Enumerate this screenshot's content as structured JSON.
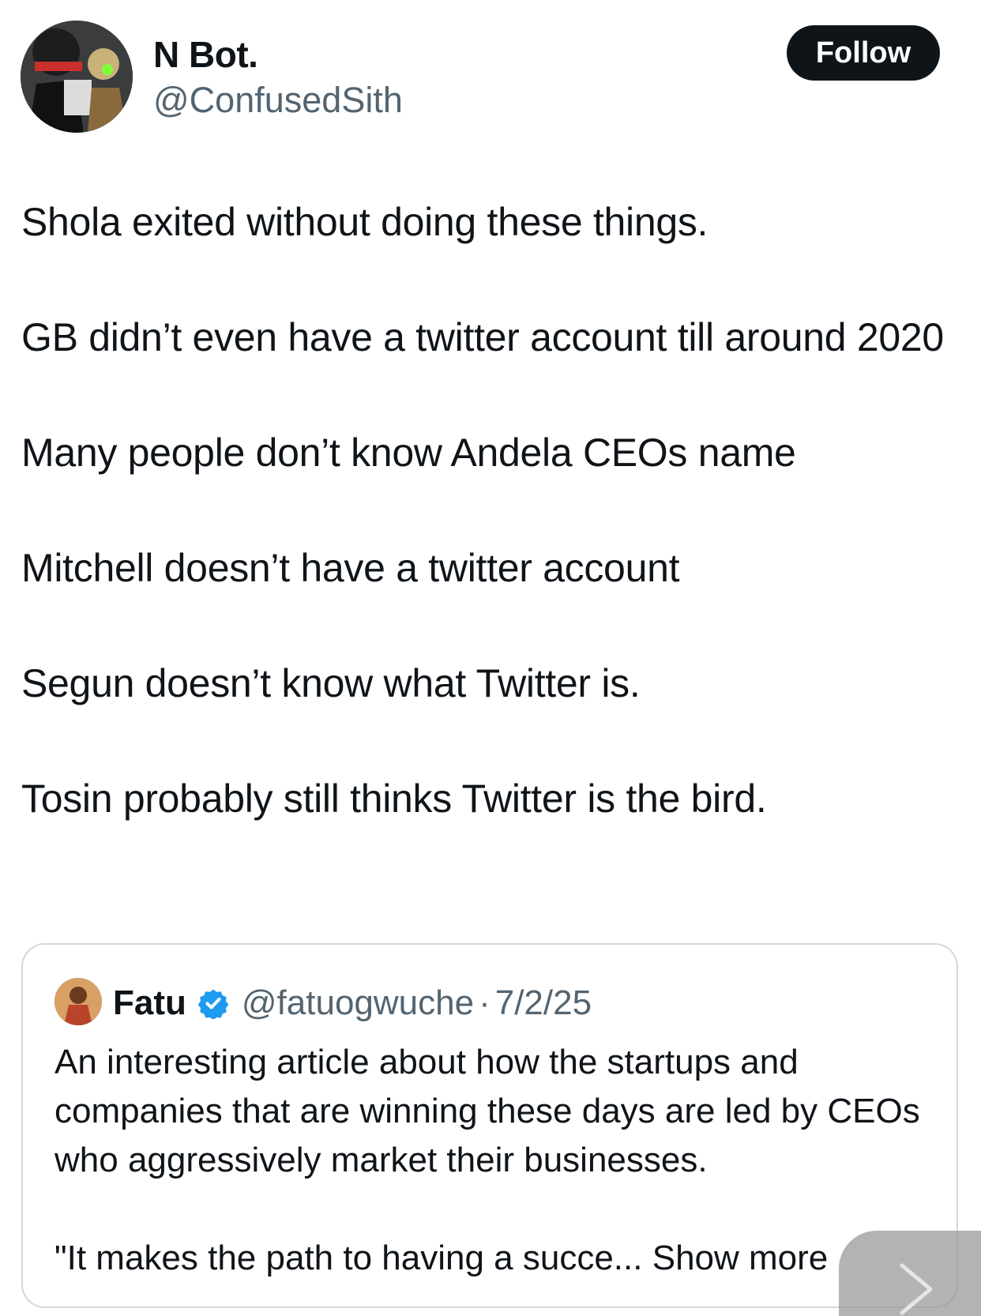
{
  "tweet": {
    "display_name": "N Bot.",
    "handle": "@ConfusedSith",
    "follow_label": "Follow",
    "paragraphs": [
      "Shola exited without doing these things.",
      "GB didn’t even have a twitter account till around 2020",
      "Many people don’t know Andela CEOs name",
      "Mitchell doesn’t have a twitter account",
      "Segun doesn’t know what Twitter is.",
      "Tosin probably still thinks Twitter is the bird."
    ]
  },
  "quote": {
    "display_name": "Fatu",
    "handle": "@fatuogwuche",
    "separator": "·",
    "date": "7/2/25",
    "text_line1": "An interesting article about how the startups and companies that are winning these days are led by CEOs who aggressively market their businesses.",
    "text_line2": "\"It makes the path to having a succe...",
    "show_more": "Show more"
  },
  "icons": {
    "verified": "verified-badge-icon",
    "next": "chevron-right-icon"
  },
  "colors": {
    "follow_bg": "#0f1419",
    "secondary_text": "#536471",
    "verified_blue": "#1d9bf0",
    "card_border": "#cfd9de"
  }
}
